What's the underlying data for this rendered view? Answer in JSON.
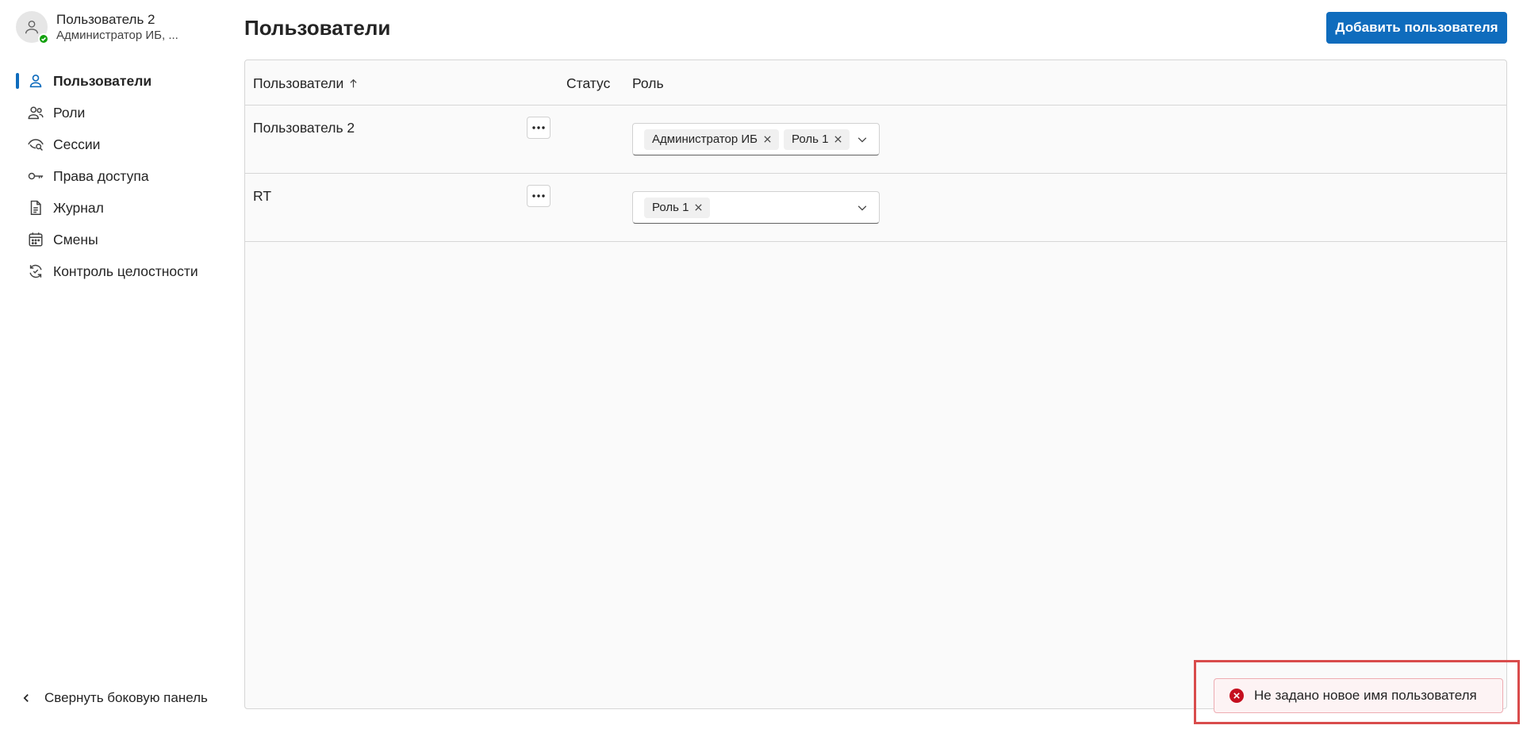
{
  "user": {
    "name": "Пользователь 2",
    "role": "Администратор ИБ, ..."
  },
  "nav": {
    "items": [
      {
        "label": "Пользователи",
        "icon": "person-icon",
        "active": true
      },
      {
        "label": "Роли",
        "icon": "people-icon",
        "active": false
      },
      {
        "label": "Сессии",
        "icon": "eye-search-icon",
        "active": false
      },
      {
        "label": "Права доступа",
        "icon": "key-icon",
        "active": false
      },
      {
        "label": "Журнал",
        "icon": "document-icon",
        "active": false
      },
      {
        "label": "Смены",
        "icon": "calendar-icon",
        "active": false
      },
      {
        "label": "Контроль целостности",
        "icon": "sync-check-icon",
        "active": false
      }
    ],
    "collapse_label": "Свернуть боковую панель"
  },
  "page": {
    "title": "Пользователи",
    "add_button_label": "Добавить пользователя"
  },
  "table": {
    "columns": {
      "users": "Пользователи",
      "status": "Статус",
      "role": "Роль"
    },
    "sort": "ascending",
    "rows": [
      {
        "name": "Пользователь 2",
        "status": "",
        "roles": [
          "Администратор ИБ",
          "Роль 1"
        ]
      },
      {
        "name": "RT",
        "status": "",
        "roles": [
          "Роль 1"
        ]
      }
    ]
  },
  "toast": {
    "type": "error",
    "message": "Не задано новое имя пользователя"
  },
  "colors": {
    "accent": "#0f6cbd",
    "presence": "#13a10e",
    "error": "#c50f1f",
    "highlight_frame": "#d94c4c"
  }
}
